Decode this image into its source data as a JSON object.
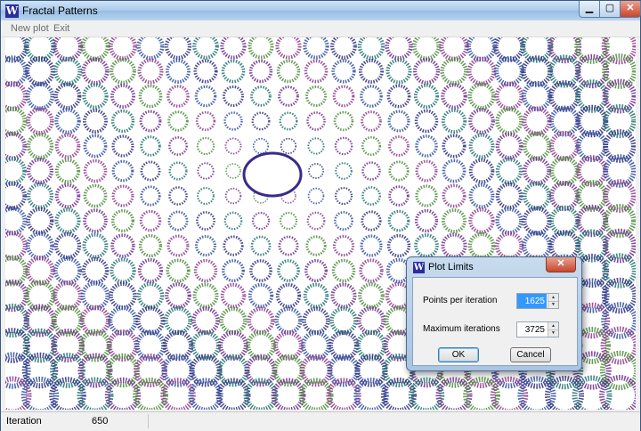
{
  "window": {
    "title": "Fractal Patterns",
    "app_icon": "W",
    "controls": {
      "minimize": "▁",
      "maximize": "▢",
      "close": "✕"
    }
  },
  "menu": {
    "items": [
      "New plot",
      "Exit"
    ]
  },
  "status": {
    "label": "Iteration",
    "value": "650"
  },
  "dialog": {
    "title": "Plot Limits",
    "icon": "W",
    "close": "✕",
    "fields": [
      {
        "label": "Points per iteration",
        "value": "1625"
      },
      {
        "label": "Maximum iterations",
        "value": "3725"
      }
    ],
    "ok_label": "OK",
    "cancel_label": "Cancel"
  },
  "colors": {
    "accent": "#3399ff",
    "fractal": [
      "#2a2a7a",
      "#1f6e6e",
      "#6a2a8a",
      "#4a8a3a",
      "#8a3a8a",
      "#2e4e9a"
    ]
  }
}
